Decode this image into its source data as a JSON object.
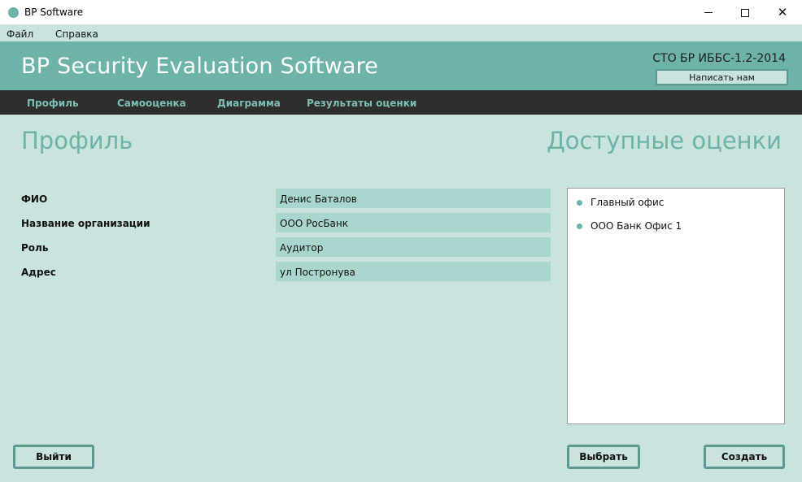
{
  "window": {
    "title": "BP Software",
    "minimize_glyph": "",
    "close_glyph": "✕"
  },
  "menu": {
    "items": [
      {
        "label": "Файл"
      },
      {
        "label": "Справка"
      }
    ]
  },
  "header": {
    "app_title": "BP Security Evaluation Software",
    "standard": "СТО БР ИББС-1.2-2014",
    "contact_label": "Написать нам"
  },
  "nav": {
    "items": [
      {
        "label": "Профиль"
      },
      {
        "label": "Самооценка"
      },
      {
        "label": "Диаграмма"
      },
      {
        "label": "Результаты оценки"
      }
    ]
  },
  "profile": {
    "title": "Профиль",
    "fields": [
      {
        "label": "ФИО",
        "value": "Денис Баталов"
      },
      {
        "label": "Название организации",
        "value": "ООО РосБанк"
      },
      {
        "label": "Роль",
        "value": "Аудитор"
      },
      {
        "label": "Адрес",
        "value": "ул Постронува"
      }
    ]
  },
  "evaluations": {
    "title": "Доступные оценки",
    "items": [
      {
        "label": "Главный офис"
      },
      {
        "label": "ООО Банк Офис 1"
      }
    ]
  },
  "buttons": {
    "exit": "Выйти",
    "select": "Выбрать",
    "create": "Создать"
  },
  "colors": {
    "accent": "#6db3a8",
    "background": "#c9e4df",
    "field_bg": "#a9d6ce",
    "nav_bg": "#2e2e2e",
    "nav_text": "#7dbfb3"
  }
}
